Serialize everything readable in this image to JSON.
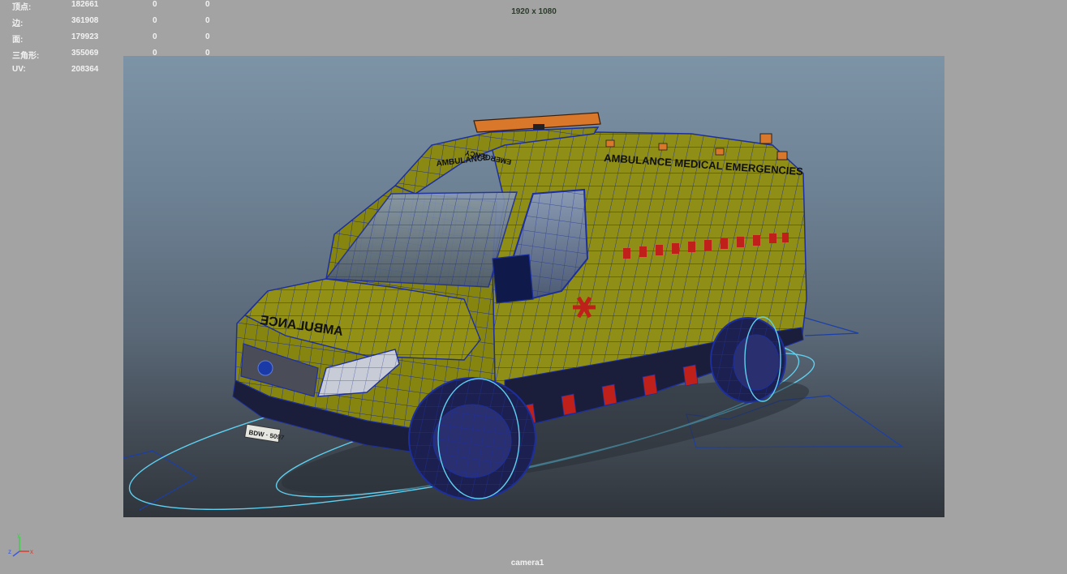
{
  "hud": {
    "rows": [
      {
        "label": "顶点:",
        "v1": "182661",
        "v2": "0",
        "v3": "0"
      },
      {
        "label": "边:",
        "v1": "361908",
        "v2": "0",
        "v3": "0"
      },
      {
        "label": "面:",
        "v1": "179923",
        "v2": "0",
        "v3": "0"
      },
      {
        "label": "三角形:",
        "v1": "355069",
        "v2": "0",
        "v3": "0"
      },
      {
        "label": "UV:",
        "v1": "208364",
        "v2": "0",
        "v3": "0"
      }
    ]
  },
  "resolution_gate": "1920 x 1080",
  "camera_name": "camera1",
  "model": {
    "side_text": "AMBULANCE  MEDICAL  EMERGENCIES",
    "hood_text": "AMBULANCE",
    "roof_text_top": "EMERGENCY",
    "roof_text_bottom": "AMBULANCE",
    "plate_text": "BDW · 5097"
  },
  "axis": {
    "x": "x",
    "y": "y",
    "z": "z"
  },
  "colors": {
    "body": "#8f8e16",
    "wire": "#1d2f9e",
    "selection": "#5fd0f0",
    "stripe_red": "#c0201a",
    "light_orange": "#d9772a"
  }
}
